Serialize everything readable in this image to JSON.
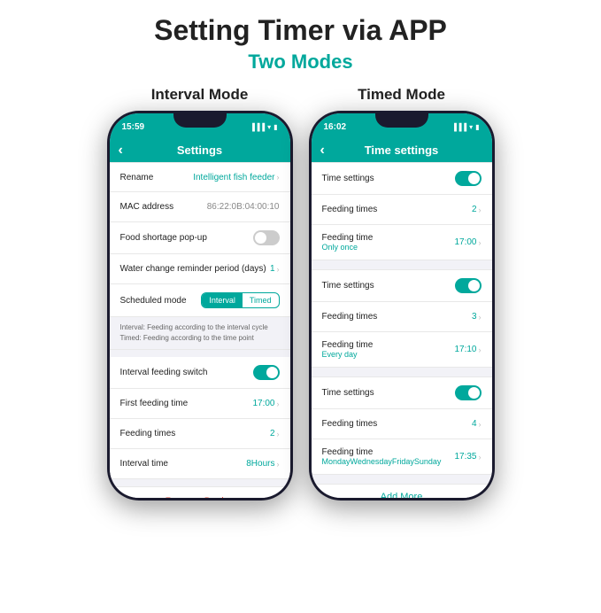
{
  "page": {
    "title": "Setting Timer via APP",
    "subtitle": "Two Modes"
  },
  "interval_mode": {
    "label": "Interval Mode",
    "status_time": "15:59",
    "header_title": "Settings",
    "items": [
      {
        "label": "Rename",
        "value": "Intelligent fish feeder",
        "type": "link"
      },
      {
        "label": "MAC address",
        "value": "86:22:0B:04:00:10",
        "type": "text"
      },
      {
        "label": "Food shortage pop-up",
        "value": "",
        "type": "toggle_off"
      },
      {
        "label": "Water change reminder period (days)",
        "value": "1",
        "type": "link"
      },
      {
        "label": "Scheduled mode",
        "value": "",
        "type": "segment"
      }
    ],
    "note": "Interval: Feeding according to the interval cycle\nTimed: Feeding according to the time point",
    "feeding_items": [
      {
        "label": "Interval feeding switch",
        "value": "",
        "type": "toggle_on"
      },
      {
        "label": "First feeding time",
        "value": "17:00",
        "type": "link"
      },
      {
        "label": "Feeding times",
        "value": "2",
        "type": "link"
      },
      {
        "label": "Interval time",
        "value": "8Hours",
        "type": "link"
      }
    ],
    "remove_label": "Remove Device",
    "segment_options": [
      "Interval",
      "Timed"
    ],
    "segment_active": "Interval"
  },
  "timed_mode": {
    "label": "Timed Mode",
    "status_time": "16:02",
    "header_title": "Time settings",
    "sections": [
      {
        "toggle": true,
        "feeding_times_label": "Feeding times",
        "feeding_times_value": "2",
        "feeding_time_label": "Feeding time",
        "feeding_time_value": "17:00",
        "period": "Only once"
      },
      {
        "toggle": true,
        "feeding_times_label": "Feeding times",
        "feeding_times_value": "3",
        "feeding_time_label": "Feeding time",
        "feeding_time_value": "17:10",
        "period": "Every day"
      },
      {
        "toggle": true,
        "feeding_times_label": "Feeding times",
        "feeding_times_value": "4",
        "feeding_time_label": "Feeding time",
        "feeding_time_value": "17:35",
        "period": "MondayWednesdayFridaySunday"
      }
    ],
    "time_settings_label": "Time settings",
    "add_more_label": "Add More"
  }
}
